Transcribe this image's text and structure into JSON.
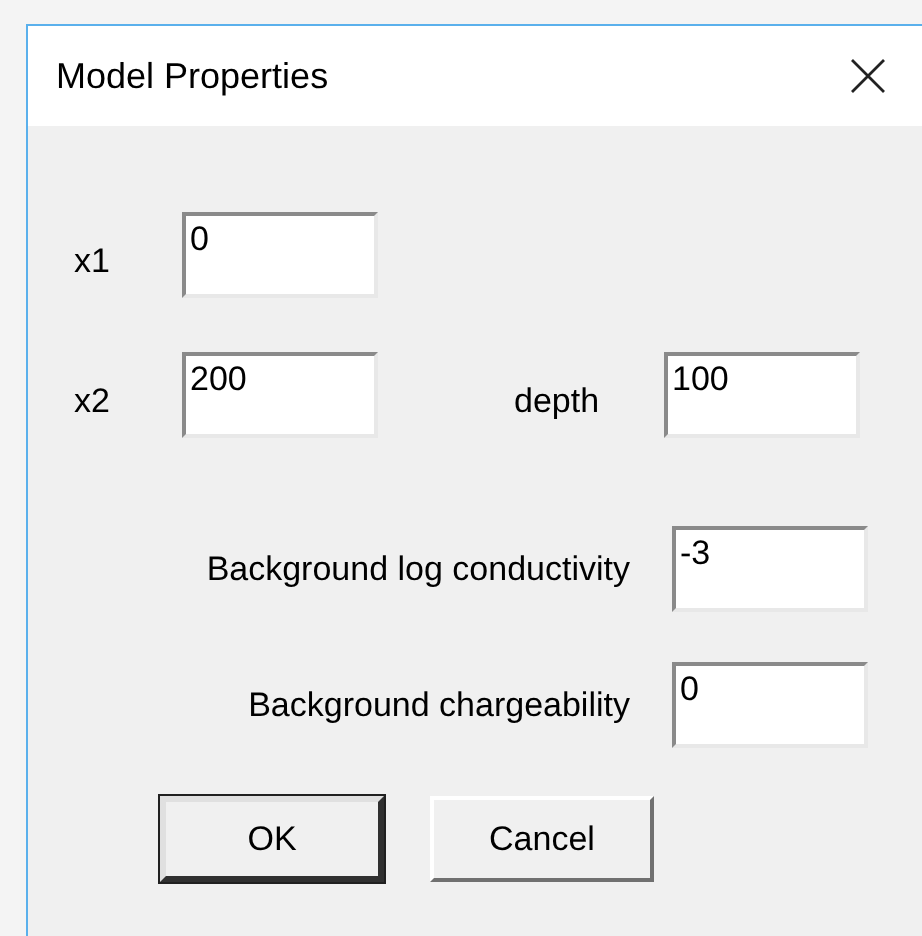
{
  "window": {
    "title": "Model Properties"
  },
  "rows": [
    {
      "kind": "short",
      "fields": [
        {
          "label": "x1",
          "value": "0"
        }
      ]
    },
    {
      "kind": "short",
      "fields": [
        {
          "label": "x2",
          "value": "200"
        },
        {
          "label": "depth",
          "value": "100"
        }
      ]
    },
    {
      "kind": "long",
      "fields": [
        {
          "label": "Background log conductivity",
          "value": "-3"
        }
      ]
    },
    {
      "kind": "long",
      "fields": [
        {
          "label": "Background chargeability",
          "value": "0"
        }
      ]
    }
  ],
  "buttons": [
    {
      "label": "OK",
      "default": true
    },
    {
      "label": "Cancel",
      "default": false
    }
  ]
}
